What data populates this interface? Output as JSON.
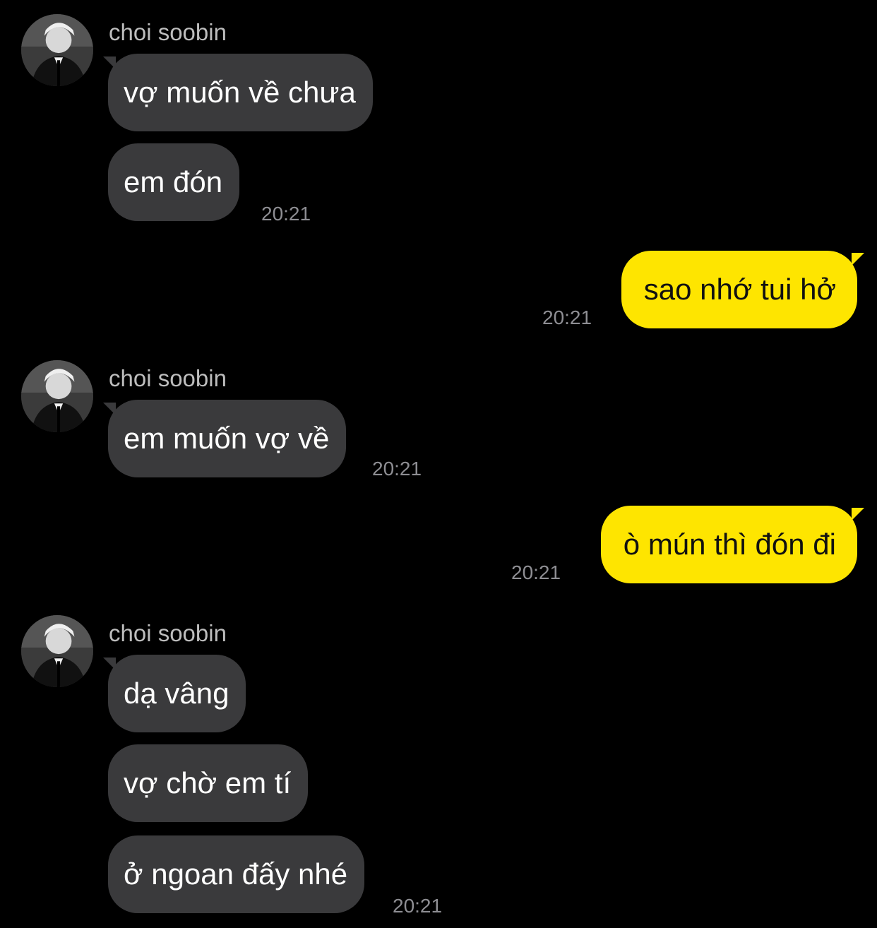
{
  "chat": {
    "groups": [
      {
        "sender": "choi soobin",
        "messages": [
          "vợ muốn về chưa",
          "em đón"
        ],
        "time": "20:21"
      },
      {
        "outgoing": true,
        "messages": [
          "sao nhớ tui hở"
        ],
        "time": "20:21"
      },
      {
        "sender": "choi soobin",
        "messages": [
          "em muốn vợ về"
        ],
        "time": "20:21"
      },
      {
        "outgoing": true,
        "messages": [
          "ò mún thì đón đi"
        ],
        "time": "20:21"
      },
      {
        "sender": "choi soobin",
        "messages": [
          "dạ vâng",
          "vợ chờ em tí",
          "ở ngoan đấy nhé"
        ],
        "time": "20:21"
      }
    ]
  },
  "theme": {
    "background": "#000000",
    "incoming_bubble": "#3a3a3c",
    "outgoing_bubble": "#fee500",
    "name_color": "#bdbdbd",
    "time_color": "#8e8e93"
  },
  "icons": {
    "avatar": "profile-photo"
  }
}
